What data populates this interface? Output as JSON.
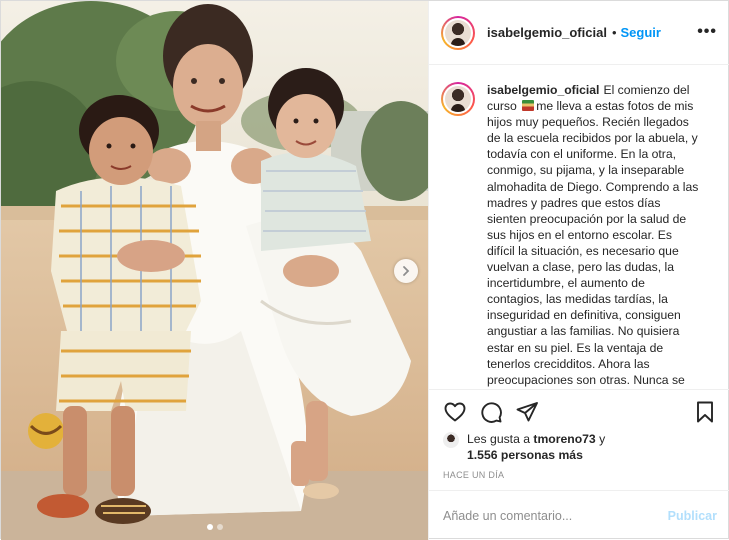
{
  "post": {
    "username": "isabelgemio_oficial",
    "separator": "•",
    "follow_label": "Seguir",
    "more_label": "•••"
  },
  "caption": {
    "username": "isabelgemio_oficial",
    "text_part1": "El comienzo del curso",
    "emoji": "books-emoji",
    "text_part2": "me lleva a estas fotos de mis hijos muy pequeños. Recién llegados de la escuela recibidos por la abuela, y todavía con el uniforme. En la otra, conmigo, su pijama, y la inseparable almohadita de Diego. Comprendo a las madres y padres que estos días sienten preocupación por la salud de sus hijos en el entorno escolar. Es difícil la situación, es necesario que vuelvan a clase, pero las dudas, la incertidumbre, el aumento de contagios, las medidas tardías, la inseguridad en definitiva, consiguen angustiar a las familias. No quisiera estar en su piel. Es la ventaja de tenerlos crecidditos. Ahora las preocupaciones  son otras. Nunca se"
  },
  "likes": {
    "prefix": "Les gusta a",
    "user": "tmoreno73",
    "joiner": "y",
    "others": "1.556 personas más"
  },
  "timestamp": "HACE UN DÍA",
  "comment": {
    "placeholder": "Añade un comentario...",
    "publish_label": "Publicar"
  },
  "colors": {
    "link": "#0095f6",
    "publish_disabled": "#b2dffc",
    "text": "#262626",
    "muted": "#8e8e8e",
    "border": "#dbdbdb"
  },
  "icons": {
    "like": "heart-icon",
    "comment": "comment-icon",
    "share": "paper-plane-icon",
    "save": "bookmark-icon",
    "next": "chevron-right-icon"
  },
  "carousel": {
    "slides": 2,
    "current": 1
  }
}
